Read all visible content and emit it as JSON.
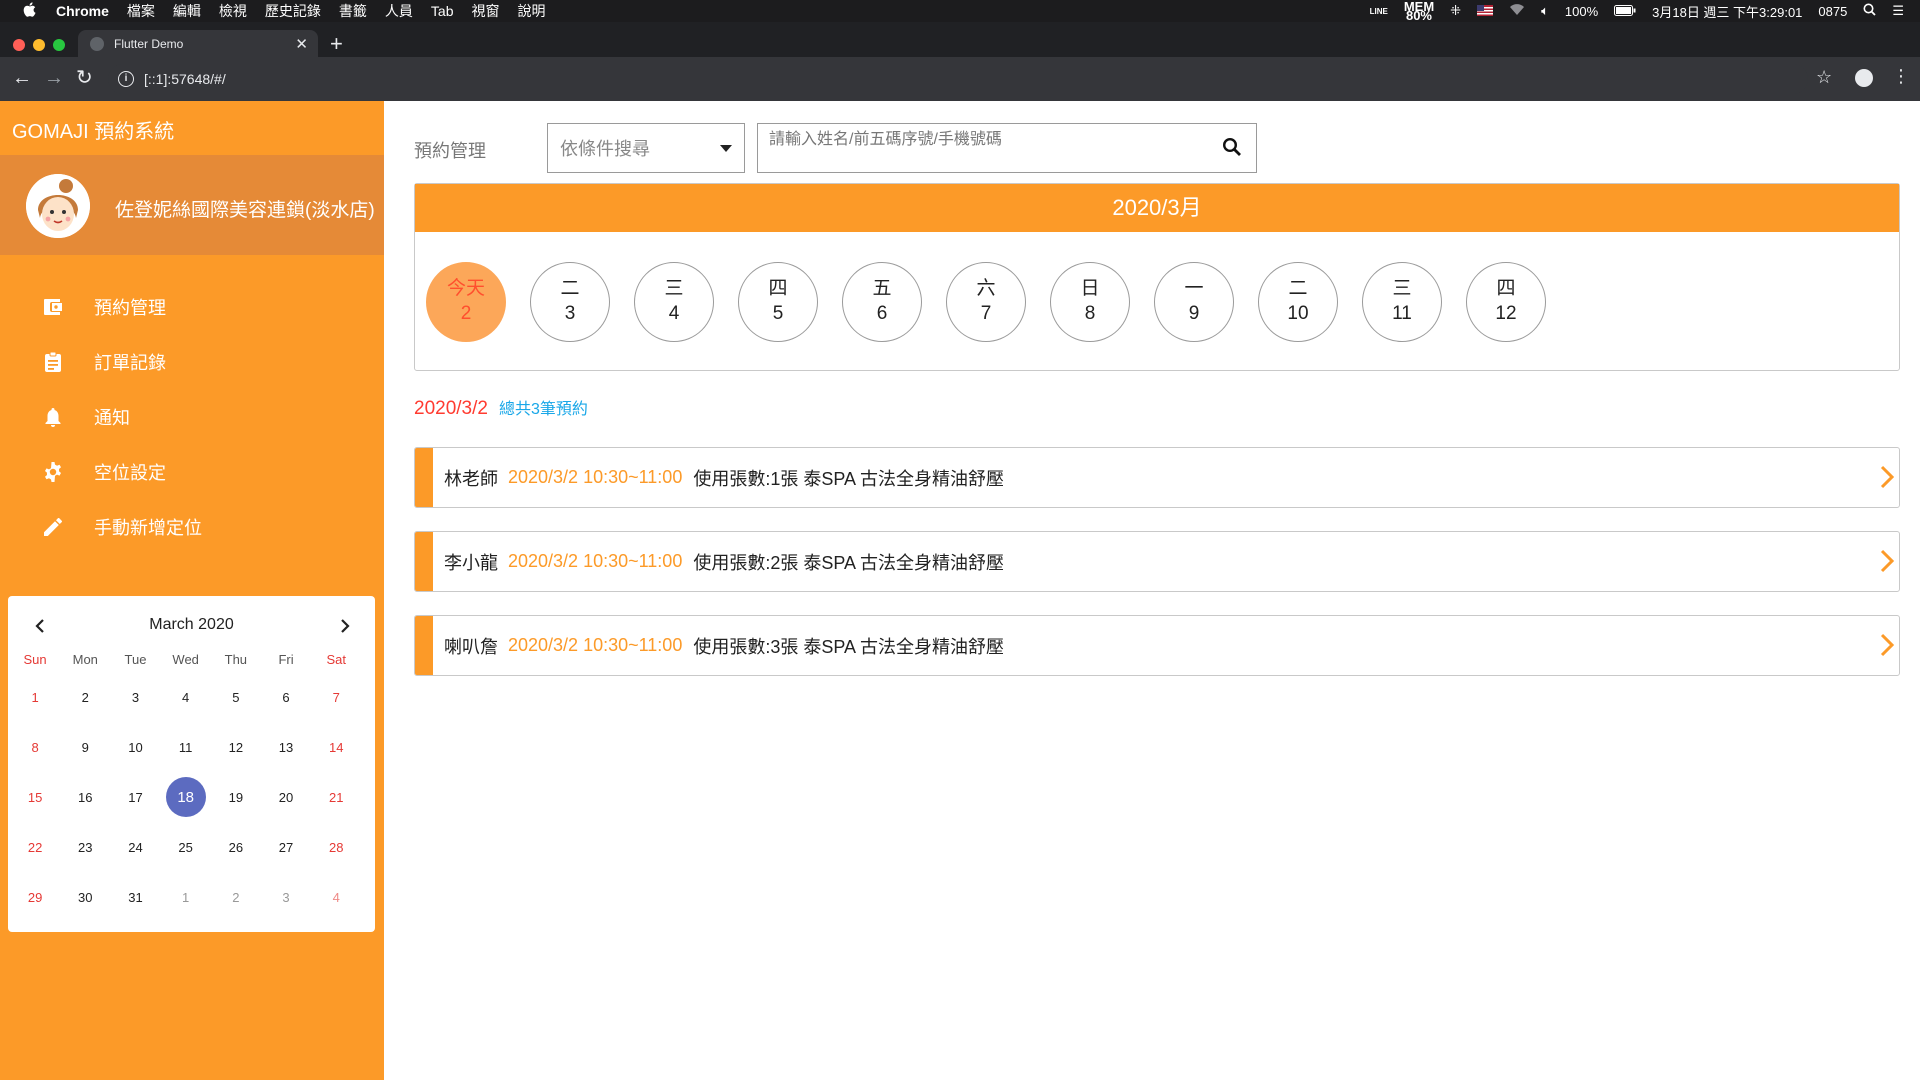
{
  "menubar": {
    "app": "Chrome",
    "items": [
      "檔案",
      "編輯",
      "檢視",
      "歷史記錄",
      "書籤",
      "人員",
      "Tab",
      "視窗",
      "說明"
    ],
    "mem_label": "MEM",
    "mem_value": "80%",
    "battery": "100%",
    "datetime": "3月18日 週三 下午3:29:01",
    "extra": "0875"
  },
  "browser": {
    "tab_title": "Flutter Demo",
    "url": "[::1]:57648/#/"
  },
  "sidebar": {
    "app_title": "GOMAJI 預約系統",
    "store_name": "佐登妮絲國際美容連鎖(淡水店)",
    "menu": [
      {
        "label": "預約管理",
        "icon": "wallet-icon"
      },
      {
        "label": "訂單記錄",
        "icon": "clipboard-icon"
      },
      {
        "label": "通知",
        "icon": "bell-icon"
      },
      {
        "label": "空位設定",
        "icon": "gear-icon"
      },
      {
        "label": "手動新增定位",
        "icon": "pencil-icon"
      }
    ]
  },
  "calendar": {
    "title": "March 2020",
    "weekdays": [
      "Sun",
      "Mon",
      "Tue",
      "Wed",
      "Thu",
      "Fri",
      "Sat"
    ],
    "selected_day": 18,
    "days": [
      "1",
      "2",
      "3",
      "4",
      "5",
      "6",
      "7",
      "8",
      "9",
      "10",
      "11",
      "12",
      "13",
      "14",
      "15",
      "16",
      "17",
      "18",
      "19",
      "20",
      "21",
      "22",
      "23",
      "24",
      "25",
      "26",
      "27",
      "28",
      "29",
      "30",
      "31",
      "1",
      "2",
      "3",
      "4"
    ]
  },
  "main": {
    "page_label": "預約管理",
    "filter_value": "依條件搜尋",
    "search_placeholder": "請輸入姓名/前五碼序號/手機號碼",
    "month_title": "2020/3月",
    "days": [
      {
        "weekday": "今天",
        "date": "2",
        "today": true
      },
      {
        "weekday": "二",
        "date": "3"
      },
      {
        "weekday": "三",
        "date": "4"
      },
      {
        "weekday": "四",
        "date": "5"
      },
      {
        "weekday": "五",
        "date": "6"
      },
      {
        "weekday": "六",
        "date": "7"
      },
      {
        "weekday": "日",
        "date": "8"
      },
      {
        "weekday": "一",
        "date": "9"
      },
      {
        "weekday": "二",
        "date": "10"
      },
      {
        "weekday": "三",
        "date": "11"
      },
      {
        "weekday": "四",
        "date": "12"
      }
    ],
    "selected_date": "2020/3/2",
    "total_text": "總共3筆預約",
    "appointments": [
      {
        "name": "林老師",
        "time": "2020/3/2 10:30~11:00",
        "desc": "使用張數:1張 泰SPA 古法全身精油舒壓"
      },
      {
        "name": "李小龍",
        "time": "2020/3/2 10:30~11:00",
        "desc": "使用張數:2張 泰SPA 古法全身精油舒壓"
      },
      {
        "name": "喇叭詹",
        "time": "2020/3/2 10:30~11:00",
        "desc": "使用張數:3張 泰SPA 古法全身精油舒壓"
      }
    ]
  },
  "colors": {
    "brand_orange": "#fc9a28",
    "profile_bg": "#e58a37",
    "today_red": "#ff3b30",
    "link_blue": "#19a7e8",
    "selected_purple": "#5c6bc0"
  }
}
